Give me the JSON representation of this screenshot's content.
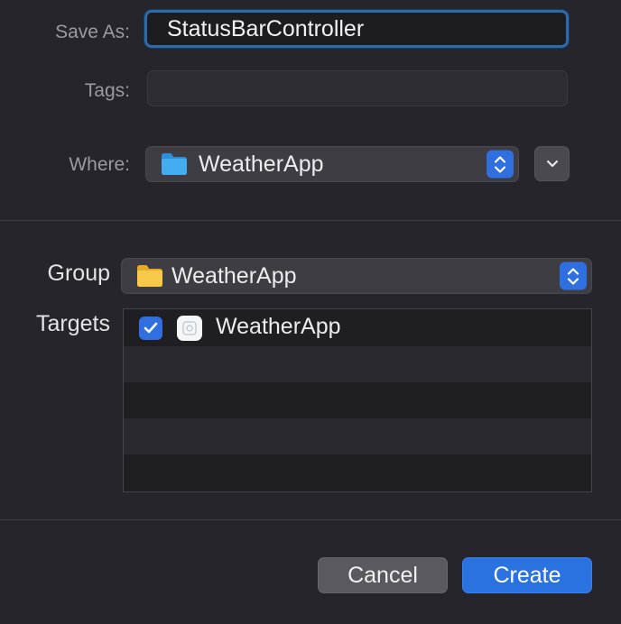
{
  "form": {
    "save_as_label": "Save As:",
    "save_as_value": "StatusBarController",
    "tags_label": "Tags:",
    "tags_value": "",
    "where_label": "Where:",
    "where_value": "WeatherApp",
    "where_icon": "folder-blue-icon"
  },
  "group": {
    "label": "Group",
    "value": "WeatherApp",
    "icon": "folder-yellow-icon"
  },
  "targets": {
    "label": "Targets",
    "items": [
      {
        "name": "WeatherApp",
        "checked": true,
        "icon": "app-icon"
      }
    ]
  },
  "buttons": {
    "cancel": "Cancel",
    "create": "Create"
  },
  "colors": {
    "accent": "#2f6fdf",
    "background": "#26252b",
    "folder_blue": "#39a8f0",
    "folder_yellow": "#f7c948"
  }
}
